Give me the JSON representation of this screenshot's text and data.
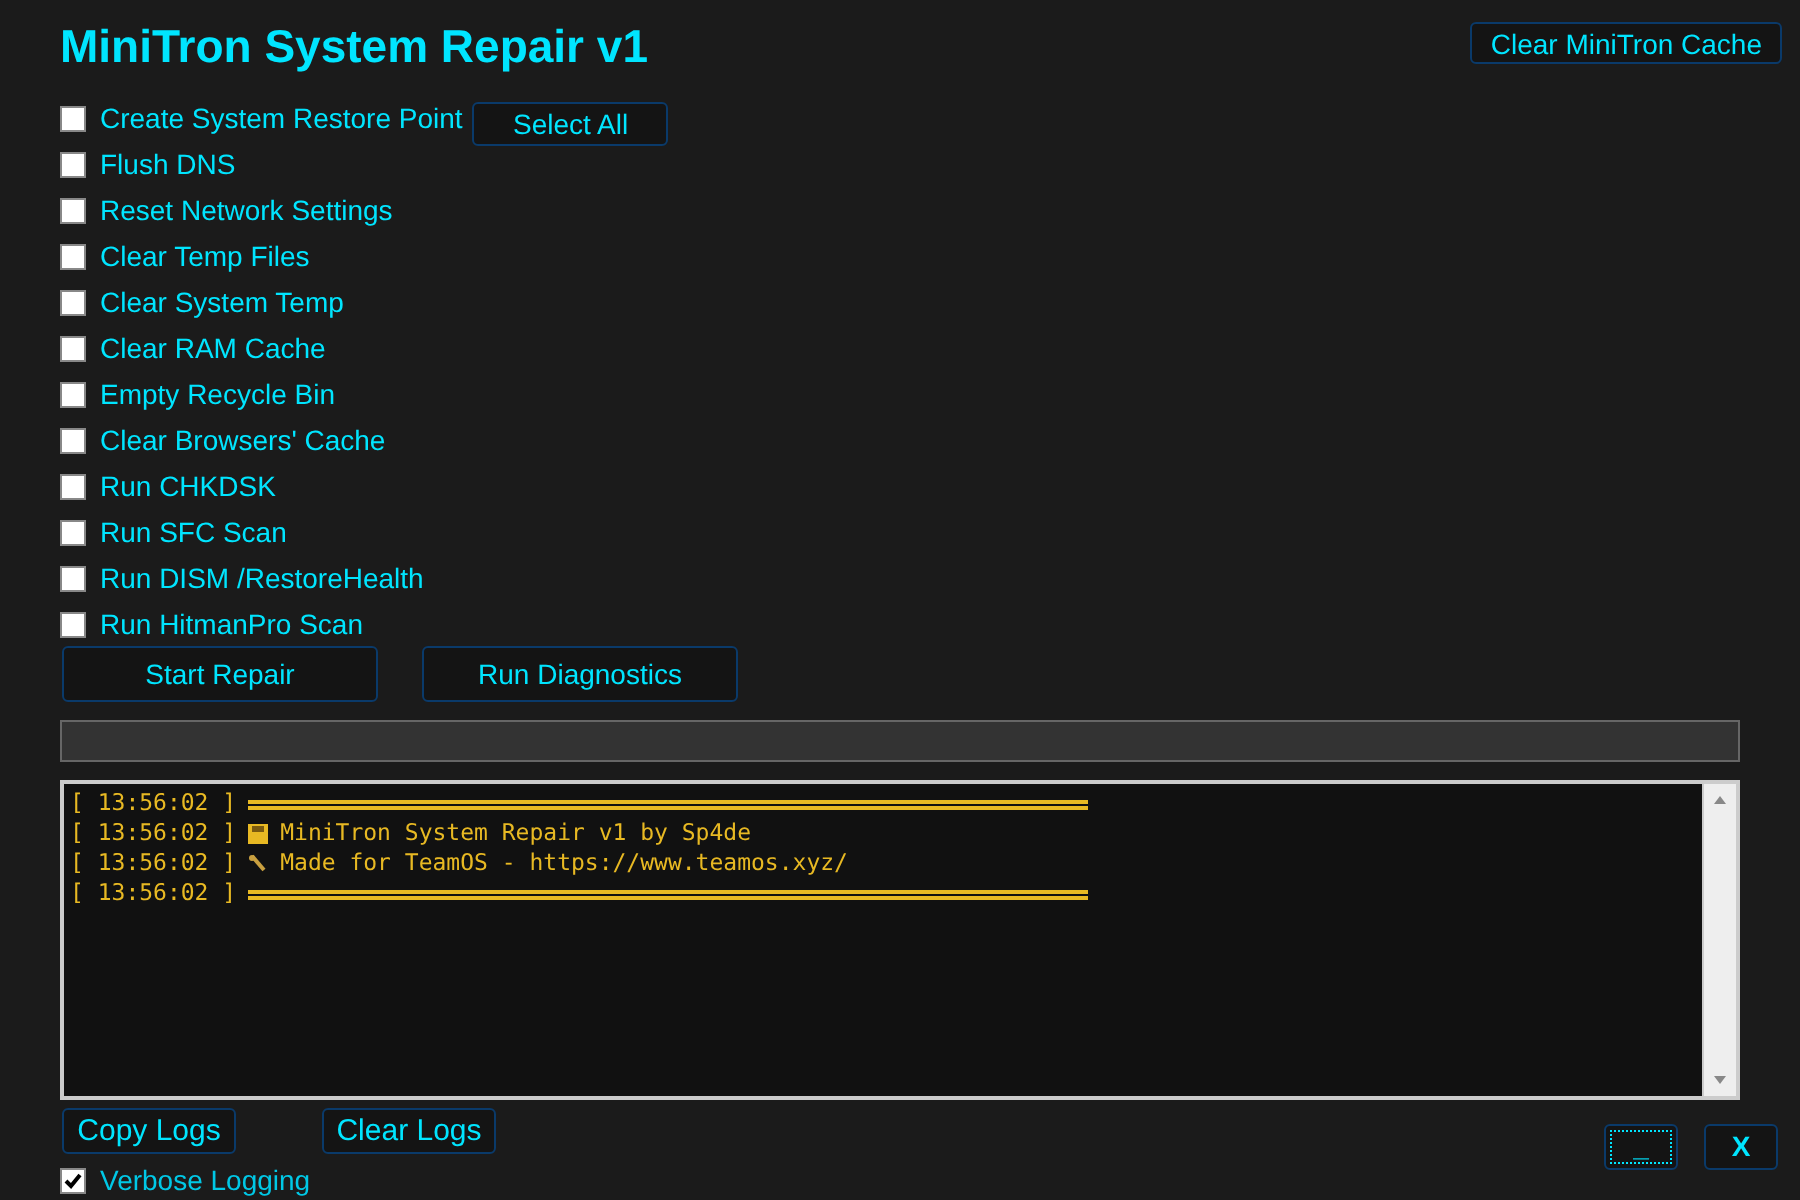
{
  "title": "MiniTron System Repair v1",
  "clear_cache_button": "Clear MiniTron Cache",
  "select_all_button": "Select All",
  "tasks": [
    {
      "label": "Create System Restore Point",
      "checked": false
    },
    {
      "label": "Flush DNS",
      "checked": false
    },
    {
      "label": "Reset Network Settings",
      "checked": false
    },
    {
      "label": "Clear Temp Files",
      "checked": false
    },
    {
      "label": "Clear System Temp",
      "checked": false
    },
    {
      "label": "Clear RAM Cache",
      "checked": false
    },
    {
      "label": "Empty Recycle Bin",
      "checked": false
    },
    {
      "label": "Clear Browsers' Cache",
      "checked": false
    },
    {
      "label": "Run CHKDSK",
      "checked": false
    },
    {
      "label": "Run SFC Scan",
      "checked": false
    },
    {
      "label": "Run DISM /RestoreHealth",
      "checked": false
    },
    {
      "label": "Run HitmanPro Scan",
      "checked": false
    }
  ],
  "action_buttons": [
    "Start Repair",
    "Run Diagnostics"
  ],
  "progress": {
    "level": 0
  },
  "log": [
    {
      "time": "[ 13:56:02 ]",
      "kind": "rule"
    },
    {
      "time": "[ 13:56:02 ]",
      "kind": "disk",
      "text": "MiniTron System Repair v1 by Sp4de"
    },
    {
      "time": "[ 13:56:02 ]",
      "kind": "wrench",
      "text": "Made for TeamOS - https://www.teamos.xyz/"
    },
    {
      "time": "[ 13:56:02 ]",
      "kind": "rule"
    }
  ],
  "log_buttons": [
    "Copy Logs",
    "Clear Logs"
  ],
  "verbose": {
    "label": "Verbose Logging",
    "checked": true
  },
  "window_buttons": [
    {
      "label": "_",
      "focused": true
    },
    {
      "label": "X",
      "focused": false
    }
  ]
}
